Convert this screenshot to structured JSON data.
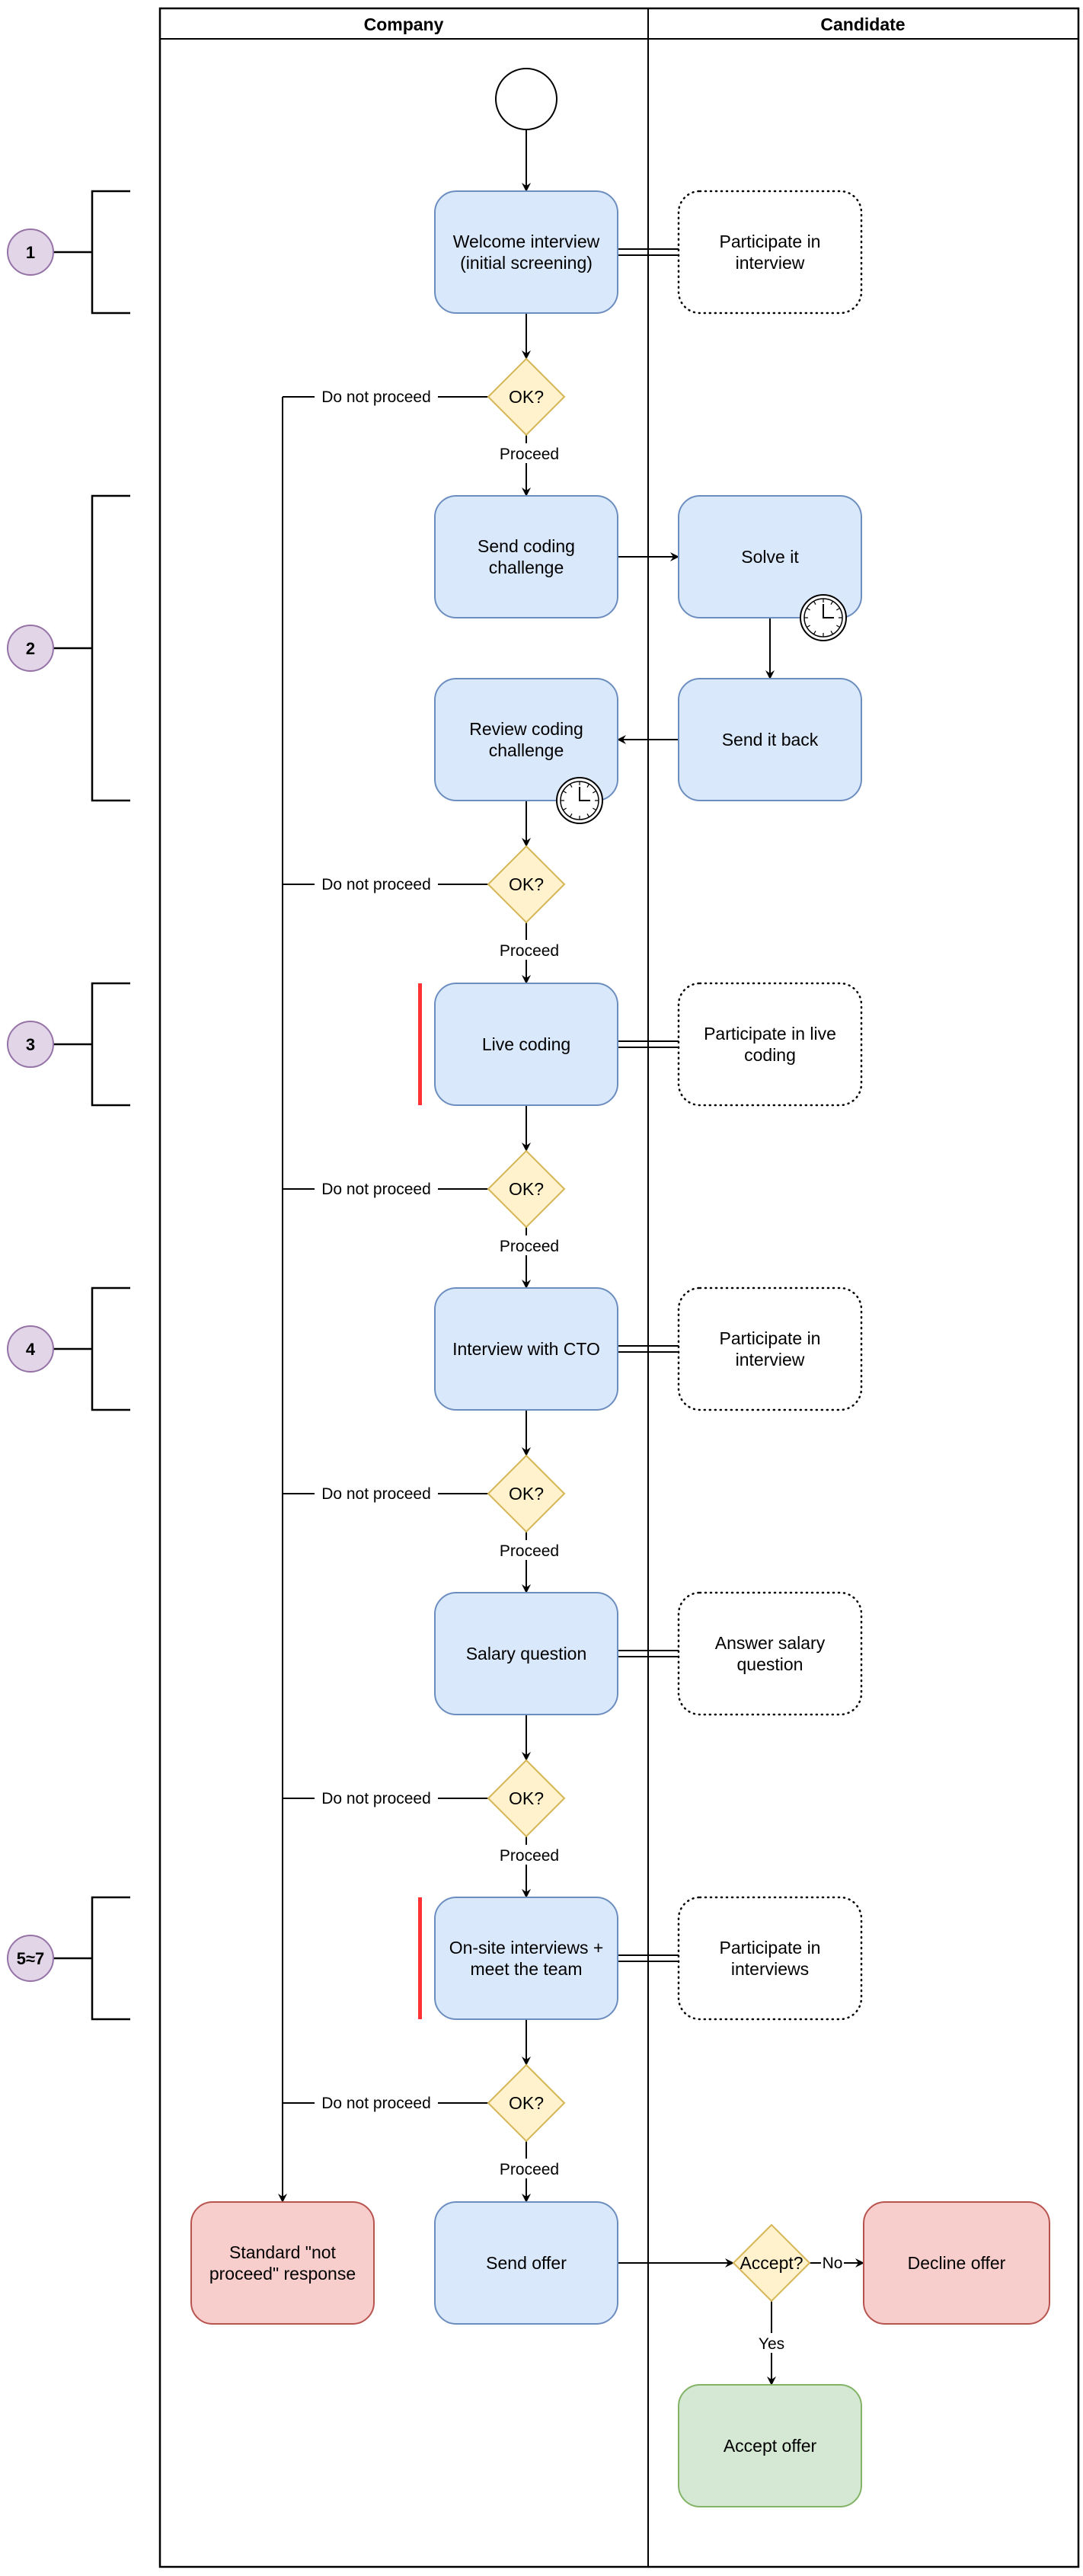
{
  "pool": {
    "lanes": [
      {
        "id": "company",
        "title": "Company"
      },
      {
        "id": "candidate",
        "title": "Candidate"
      }
    ]
  },
  "colors": {
    "task_fill": "#dae8fc",
    "task_stroke": "#6c8ebf",
    "gateway_fill": "#fff2cc",
    "gateway_stroke": "#d6b656",
    "reject_fill": "#f8cecc",
    "reject_stroke": "#b85450",
    "accept_fill": "#d5e8d4",
    "accept_stroke": "#82b366",
    "phase_fill": "#e1d5e7",
    "phase_stroke": "#9673a6",
    "highlight": "#ff3333"
  },
  "phases": [
    {
      "label": "1",
      "step": 0,
      "span": 1
    },
    {
      "label": "2",
      "step": 1,
      "span": 2
    },
    {
      "label": "3",
      "step": 3,
      "span": 1
    },
    {
      "label": "4",
      "step": 4,
      "span": 1
    },
    {
      "label": "5≈7",
      "step": 6,
      "span": 1
    }
  ],
  "start_event": {
    "name": "start"
  },
  "company_tasks": [
    {
      "id": "welcome",
      "lines": [
        "Welcome interview",
        "(initial screening)"
      ],
      "step": 0,
      "timer": false,
      "highlight": false
    },
    {
      "id": "send-challenge",
      "lines": [
        "Send coding",
        "challenge"
      ],
      "step": 1,
      "timer": false,
      "highlight": false
    },
    {
      "id": "review-challenge",
      "lines": [
        "Review coding",
        "challenge"
      ],
      "step": 2,
      "timer": true,
      "highlight": false
    },
    {
      "id": "live-coding",
      "lines": [
        "Live coding"
      ],
      "step": 3,
      "timer": false,
      "highlight": true
    },
    {
      "id": "interview-cto",
      "lines": [
        "Interview with CTO"
      ],
      "step": 4,
      "timer": false,
      "highlight": false
    },
    {
      "id": "salary-question",
      "lines": [
        "Salary question"
      ],
      "step": 5,
      "timer": false,
      "highlight": false
    },
    {
      "id": "onsite-interviews",
      "lines": [
        "On-site interviews +",
        "meet the team"
      ],
      "step": 6,
      "timer": false,
      "highlight": true
    },
    {
      "id": "send-offer",
      "lines": [
        "Send offer"
      ],
      "step": 7,
      "timer": false,
      "highlight": false
    }
  ],
  "candidate_tasks": [
    {
      "id": "participate-interview",
      "lines": [
        "Participate in",
        "interview"
      ],
      "step": 0,
      "style": "dotted",
      "timer": false
    },
    {
      "id": "solve-it",
      "lines": [
        "Solve it"
      ],
      "step": 1,
      "style": "solid",
      "timer": true
    },
    {
      "id": "send-it-back",
      "lines": [
        "Send it back"
      ],
      "step": 2,
      "style": "solid",
      "timer": false
    },
    {
      "id": "participate-live-coding",
      "lines": [
        "Participate in live",
        "coding"
      ],
      "step": 3,
      "style": "dotted",
      "timer": false
    },
    {
      "id": "participate-interview-cto",
      "lines": [
        "Participate in",
        "interview"
      ],
      "step": 4,
      "style": "dotted",
      "timer": false
    },
    {
      "id": "answer-salary",
      "lines": [
        "Answer salary",
        "question"
      ],
      "step": 5,
      "style": "dotted",
      "timer": false
    },
    {
      "id": "participate-interviews",
      "lines": [
        "Participate in",
        "interviews"
      ],
      "step": 6,
      "style": "dotted",
      "timer": false
    }
  ],
  "gateways": [
    {
      "label": "OK?",
      "after_step": 0,
      "no_label": "Do not proceed",
      "yes_label": "Proceed"
    },
    {
      "label": "OK?",
      "after_step": 2,
      "no_label": "Do not proceed",
      "yes_label": "Proceed"
    },
    {
      "label": "OK?",
      "after_step": 3,
      "no_label": "Do not proceed",
      "yes_label": "Proceed"
    },
    {
      "label": "OK?",
      "after_step": 4,
      "no_label": "Do not proceed",
      "yes_label": "Proceed"
    },
    {
      "label": "OK?",
      "after_step": 5,
      "no_label": "Do not proceed",
      "yes_label": "Proceed"
    },
    {
      "label": "OK?",
      "after_step": 6,
      "no_label": "Do not proceed",
      "yes_label": "Proceed"
    }
  ],
  "reject_task": {
    "lines": [
      "Standard \"not",
      "proceed\" response"
    ]
  },
  "accept_gateway": {
    "label": "Accept?",
    "no_label": "No",
    "yes_label": "Yes"
  },
  "decline_task": {
    "lines": [
      "Decline offer"
    ]
  },
  "accept_task": {
    "lines": [
      "Accept offer"
    ]
  }
}
